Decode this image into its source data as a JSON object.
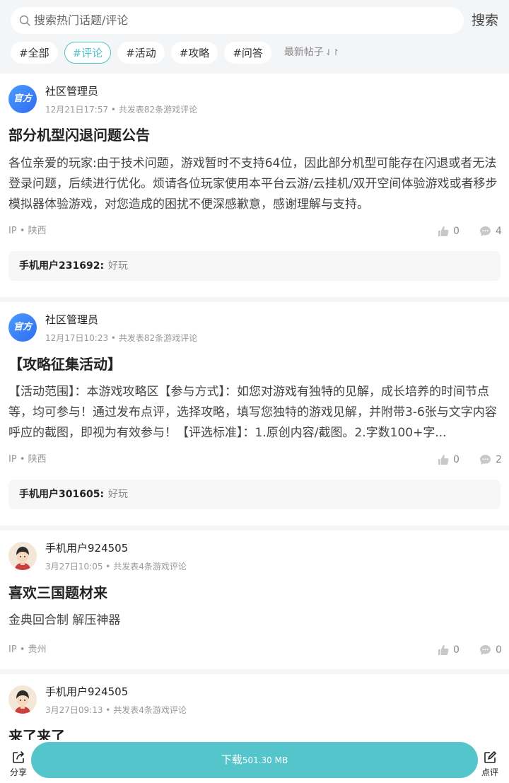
{
  "search": {
    "placeholder": "搜索热门话题/评论",
    "button": "搜索"
  },
  "filters": {
    "chips": [
      "#全部",
      "#评论",
      "#活动",
      "#攻略",
      "#问答"
    ],
    "active": "#评论",
    "sort": "最新帖子"
  },
  "posts": [
    {
      "avatar_text": "官方",
      "author": "社区管理员",
      "meta": "12月21日17:57 • 共发表82条游戏评论",
      "title": "部分机型闪退问题公告",
      "body": "各位亲爱的玩家:由于技术问题，游戏暂时不支持64位，因此部分机型可能存在闪退或者无法登录问题，后续进行优化。烦请各位玩家使用本平台云游/云挂机/双开空间体验游戏或者移步模拟器体验游戏，对您造成的困扰不便深感歉意，感谢理解与支持。",
      "ip": "IP • 陕西",
      "likes": "0",
      "comments": "4",
      "reply_user": "手机用户231692:",
      "reply_text": "好玩"
    },
    {
      "avatar_text": "官方",
      "author": "社区管理员",
      "meta": "12月17日10:23 • 共发表82条游戏评论",
      "title": "【攻略征集活动】",
      "body": "【活动范围】：本游戏攻略区【参与方式】：如您对游戏有独特的见解，成长培养的时间节点等，均可参与！通过发布点评，选择攻略，填写您独特的游戏见解，并附带3-6张与文字内容呼应的截图，即视为有效参与！【评选标准】：1.原创内容/截图。2.字数100+字...",
      "ip": "IP • 陕西",
      "likes": "0",
      "comments": "2",
      "reply_user": "手机用户301605:",
      "reply_text": "好玩"
    },
    {
      "author": "手机用户924505",
      "meta": "3月27日10:05 • 共发表4条游戏评论",
      "title": "喜欢三国题材来",
      "body": "金典回合制 解压神器",
      "ip": "IP • 贵州",
      "likes": "0",
      "comments": "0"
    },
    {
      "author": "手机用户924505",
      "meta": "3月27日09:13 • 共发表4条游戏评论",
      "title": "来了来了"
    }
  ],
  "bottom": {
    "share": "分享",
    "download": "下载",
    "size": "501.30 MB",
    "review": "点评"
  },
  "colors": {
    "accent": "#55c5cc",
    "chip_active": "#4fc1c9",
    "background": "#f4f5f7"
  }
}
